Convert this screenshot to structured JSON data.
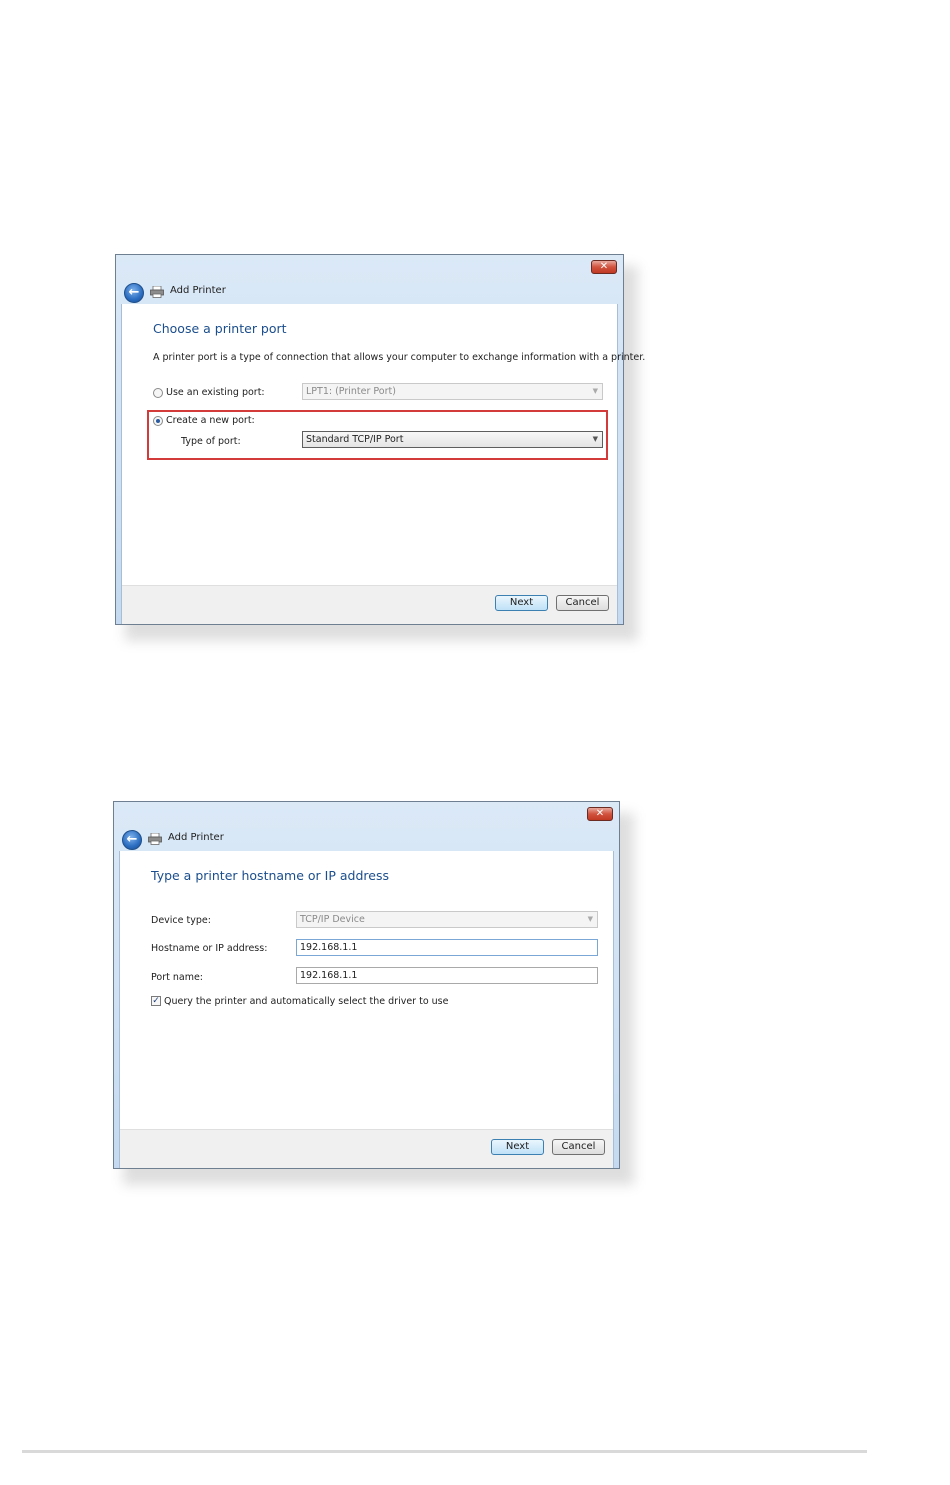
{
  "dialog1": {
    "window_title": "Add Printer",
    "close_glyph": "✕",
    "back_glyph": "←",
    "heading": "Choose a printer port",
    "description": "A printer port is a type of connection that allows your computer to exchange information with a printer.",
    "existing_port_label": "Use an existing port:",
    "existing_port_value": "LPT1: (Printer Port)",
    "new_port_label": "Create a new port:",
    "type_of_port_label": "Type of port:",
    "type_of_port_value": "Standard TCP/IP Port",
    "selected_option": "Create a new port:",
    "next_label": "Next",
    "cancel_label": "Cancel"
  },
  "dialog2": {
    "window_title": "Add Printer",
    "close_glyph": "✕",
    "back_glyph": "←",
    "heading": "Type a printer hostname or IP address",
    "device_type_label": "Device type:",
    "device_type_value": "TCP/IP Device",
    "hostname_label": "Hostname or IP address:",
    "hostname_value": "192.168.1.1",
    "port_name_label": "Port name:",
    "port_name_value": "192.168.1.1",
    "query_label": "Query the printer and automatically select the driver to use",
    "query_checked": true,
    "next_label": "Next",
    "cancel_label": "Cancel"
  },
  "colors": {
    "heading": "#1b4e8d",
    "highlight": "#d33a3a",
    "close_button": "#c13923"
  }
}
